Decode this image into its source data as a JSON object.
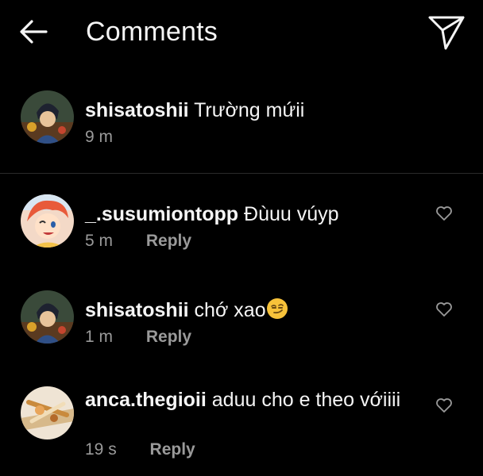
{
  "header": {
    "title": "Comments",
    "back_icon": "arrow-left-icon",
    "send_icon": "paper-plane-icon"
  },
  "caption": {
    "username": "shisatoshii",
    "text": "Trường mứii",
    "time": "9 m"
  },
  "comments": [
    {
      "username": "_.susumiontopp",
      "text": "Đùuu vúyp",
      "time": "5 m",
      "reply_label": "Reply",
      "like_icon": "heart-outline-icon"
    },
    {
      "username": "shisatoshii",
      "text": "chớ xao",
      "emoji": "smirking-face-emoji",
      "time": "1 m",
      "reply_label": "Reply",
      "like_icon": "heart-outline-icon"
    },
    {
      "username": "anca.thegioii",
      "text": "aduu cho e theo vớiiii",
      "time": "19 s",
      "reply_label": "Reply",
      "like_icon": "heart-outline-icon"
    }
  ],
  "colors": {
    "background": "#000000",
    "text": "#f5f5f5",
    "secondary_text": "#9a9a9a",
    "divider": "#2a2a2a"
  }
}
